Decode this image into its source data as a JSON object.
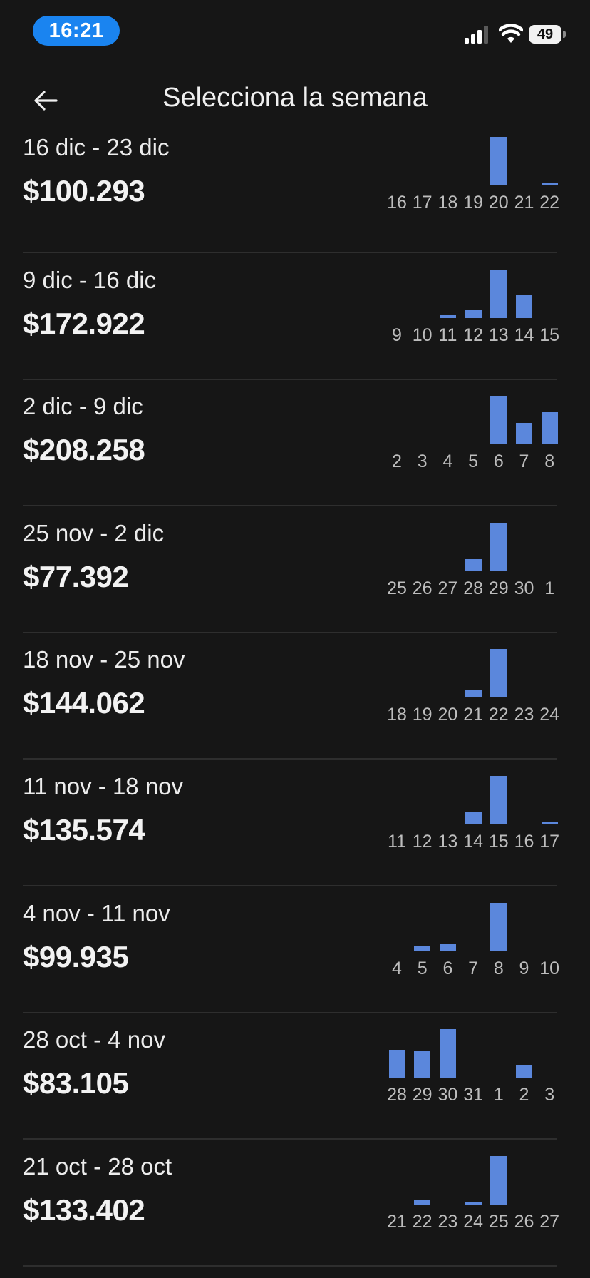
{
  "status_bar": {
    "time": "16:21",
    "battery": "49",
    "icons": [
      "signal-icon",
      "wifi-icon",
      "battery-icon"
    ]
  },
  "header": {
    "title": "Selecciona la semana",
    "back_icon": "arrow-left-icon"
  },
  "colors": {
    "background": "#161616",
    "bar": "#5b87dc",
    "time_pill": "#1a84f0",
    "divider": "#2e2e2e"
  },
  "weeks": [
    {
      "range": "16 dic - 23 dic",
      "amount": "$100.293",
      "days": [
        "16",
        "17",
        "18",
        "19",
        "20",
        "21",
        "22"
      ],
      "levels": [
        0,
        0,
        0,
        0,
        1.0,
        0,
        0.06
      ]
    },
    {
      "range": "9 dic - 16 dic",
      "amount": "$172.922",
      "days": [
        "9",
        "10",
        "11",
        "12",
        "13",
        "14",
        "15"
      ],
      "levels": [
        0,
        0,
        0.06,
        0.16,
        1.0,
        0.49,
        0
      ]
    },
    {
      "range": "2 dic - 9 dic",
      "amount": "$208.258",
      "days": [
        "2",
        "3",
        "4",
        "5",
        "6",
        "7",
        "8"
      ],
      "levels": [
        0,
        0,
        0,
        0,
        1.0,
        0.44,
        0.66
      ]
    },
    {
      "range": "25 nov - 2 dic",
      "amount": "$77.392",
      "days": [
        "25",
        "26",
        "27",
        "28",
        "29",
        "30",
        "1"
      ],
      "levels": [
        0,
        0,
        0,
        0.25,
        1.0,
        0,
        0
      ]
    },
    {
      "range": "18 nov - 25 nov",
      "amount": "$144.062",
      "days": [
        "18",
        "19",
        "20",
        "21",
        "22",
        "23",
        "24"
      ],
      "levels": [
        0,
        0,
        0,
        0.16,
        1.0,
        0,
        0
      ]
    },
    {
      "range": "11 nov - 18 nov",
      "amount": "$135.574",
      "days": [
        "11",
        "12",
        "13",
        "14",
        "15",
        "16",
        "17"
      ],
      "levels": [
        0,
        0,
        0,
        0.25,
        1.0,
        0,
        0.06
      ]
    },
    {
      "range": "4 nov - 11 nov",
      "amount": "$99.935",
      "days": [
        "4",
        "5",
        "6",
        "7",
        "8",
        "9",
        "10"
      ],
      "levels": [
        0,
        0.1,
        0.16,
        0,
        1.0,
        0,
        0
      ]
    },
    {
      "range": "28 oct - 4 nov",
      "amount": "$83.105",
      "days": [
        "28",
        "29",
        "30",
        "31",
        "1",
        "2",
        "3"
      ],
      "levels": [
        0.58,
        0.54,
        1.0,
        0,
        0,
        0.27,
        0
      ]
    },
    {
      "range": "21 oct - 28 oct",
      "amount": "$133.402",
      "days": [
        "21",
        "22",
        "23",
        "24",
        "25",
        "26",
        "27"
      ],
      "levels": [
        0,
        0.1,
        0,
        0.06,
        1.0,
        0,
        0
      ]
    }
  ]
}
